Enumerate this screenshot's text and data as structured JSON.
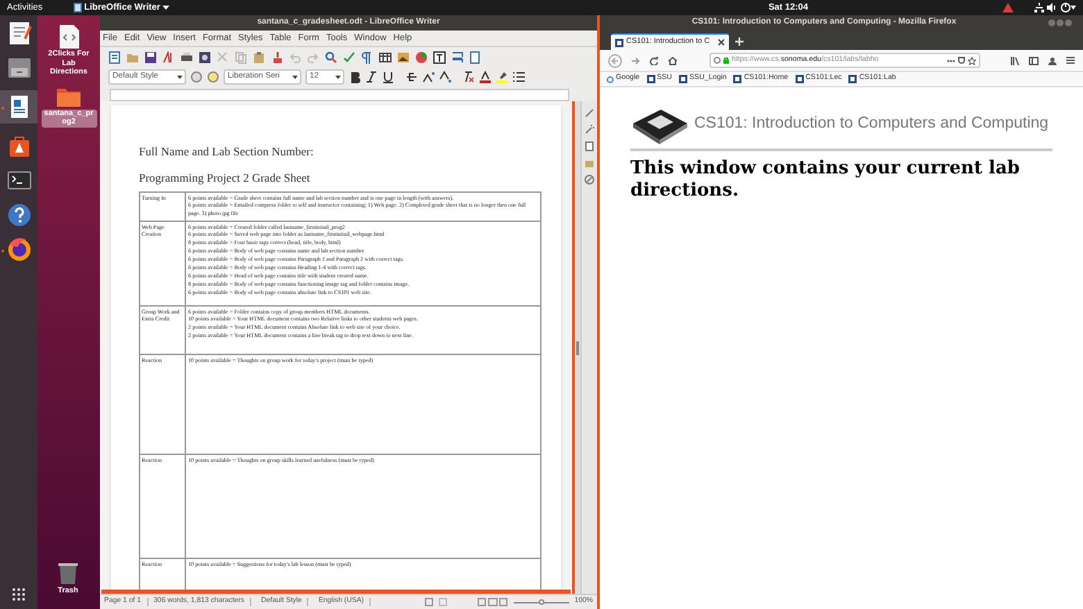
{
  "top_bar": {
    "activities": "Activities",
    "app_menu": "LibreOffice Writer",
    "clock": "Sat 12:04"
  },
  "dock": {
    "items": [
      {
        "kind": "text-editor",
        "running": false
      },
      {
        "kind": "files",
        "running": false
      },
      {
        "kind": "writer",
        "running": true
      },
      {
        "kind": "software",
        "running": false
      },
      {
        "kind": "terminal",
        "running": false
      },
      {
        "kind": "help",
        "running": false
      },
      {
        "kind": "browser",
        "running": true
      }
    ]
  },
  "desktop_icons": [
    {
      "kind": "file",
      "label": "2Clicks For Lab Directions",
      "selected": false
    },
    {
      "kind": "folder",
      "label": "santana_c_prog2",
      "selected": true
    },
    {
      "kind": "trash",
      "label": "Trash",
      "selected": false
    }
  ],
  "writer": {
    "title": "santana_c_gradesheet.odt - LibreOffice Writer",
    "menu": [
      "File",
      "Edit",
      "View",
      "Insert",
      "Format",
      "Styles",
      "Table",
      "Form",
      "Tools",
      "Window",
      "Help"
    ],
    "paragraph_style": "Default Style",
    "font_name": "Liberation Seri",
    "font_size": "12",
    "document": {
      "heading_1": "Full Name and Lab Section Number:",
      "heading_2": "Programming Project 2 Grade Sheet",
      "rows": [
        {
          "category": "Turning In",
          "lines": [
            "6 points available = Grade sheet contains full name and lab section number and is one page in length (with answers).",
            "6 points available = Emailed compress folder to self and instructor containing; 1) Web page. 2) Completed grade sheet that is no longer then one full page. 3) photo.jpg file"
          ]
        },
        {
          "category": "Web Page Creation",
          "lines": [
            "6 points available = Created folder called lastname_firstinitail_prog2",
            "6 points available = Saved web page into folder as lastname_firstinitail_webpage.html",
            "8 points available = Four basic tags correct (head, title, body, html)",
            "6 points available = Body of web page contains name and lab section number",
            "6 points available = Body of web page contains Paragraph 1 and Paragraph 2 with correct tags.",
            "6 points available = Body of web page contains Heading 1-4 with correct tags.",
            "6 points available = Head of web page contains title with student created name.",
            "8 points available = Body of web page contains functioning image tag and folder contains image.",
            "6 points available = Body of web page contains absolute link to CS101 web site."
          ]
        },
        {
          "category": "Group Work and Extra Credit",
          "lines": [
            "6 points available = Folder contains copy of group members HTML documents.",
            "10 points available = Your HTML document contains two Relative links to other students web pages.",
            "2 points available = Your HTML document contains Absolute link to web site of your choice.",
            "2 points available = Your HTML document contains a line break tag to drop text down to next line."
          ]
        },
        {
          "category": "Reaction",
          "lines": [
            "10 points available = Thoughts on group work for today's project (must be typed)"
          ]
        },
        {
          "category": "Reaction",
          "lines": [
            "10 points available = Thoughts on group skills learned usefulness (must be typed)"
          ]
        },
        {
          "category": "Reaction",
          "lines": [
            "10 points available = Suggestions for today's lab lesson (must be typed)"
          ]
        }
      ]
    },
    "status_bar": {
      "page": "Page 1 of 1",
      "words": "306 words, 1,813 characters",
      "style": "Default Style",
      "language": "English (USA)",
      "zoom": "100%"
    },
    "zoom_slider": {
      "level": 0.5
    }
  },
  "firefox": {
    "title": "CS101: Introduction to Computers and Computing - Mozilla Firefox",
    "tabs": [
      {
        "label": "CS101: Introduction to C",
        "selected": true
      }
    ],
    "url_prefix": "https://www.cs.",
    "url_domain": "sonoma.edu",
    "url_path": "/cs101/labs/labho",
    "bookmarks": [
      {
        "kind": "google",
        "label": "Google"
      },
      {
        "kind": "site",
        "label": "SSU"
      },
      {
        "kind": "site",
        "label": "SSU_Login"
      },
      {
        "kind": "site",
        "label": "CS101:Home"
      },
      {
        "kind": "site",
        "label": "CS101:Lec"
      },
      {
        "kind": "site",
        "label": "CS101:Lab"
      }
    ],
    "page": {
      "site_title": "CS101: Introduction to Computers and Computing",
      "heading": "This window contains your current lab directions."
    }
  }
}
